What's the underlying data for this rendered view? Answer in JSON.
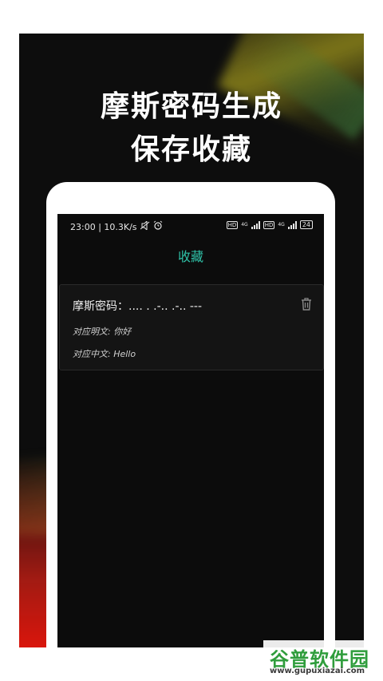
{
  "promo": {
    "headline_line1": "摩斯密码生成",
    "headline_line2": "保存收藏"
  },
  "statusbar": {
    "time_speed": "23:00 | 10.3K/s",
    "icons": [
      "mute-icon",
      "alarm-icon",
      "hd-icon",
      "signal-4g-icon",
      "hd-icon",
      "signal-4g-icon",
      "battery-icon"
    ],
    "hd_label": "HD",
    "net_label": "4G",
    "battery": "24"
  },
  "page": {
    "title": "收藏"
  },
  "favorite": {
    "morse_label": "摩斯密码：.... . .-.. .-.. ---",
    "plaintext_line": "对应明文: 你好",
    "chinese_line": "对应中文: Hello",
    "delete_icon": "trash-icon"
  },
  "watermark": {
    "title": "谷普软件园",
    "url": "www.gupuxiazai.com"
  },
  "colors": {
    "accent": "#2fc2a8",
    "background": "#0c0c0c",
    "card": "#141414"
  }
}
